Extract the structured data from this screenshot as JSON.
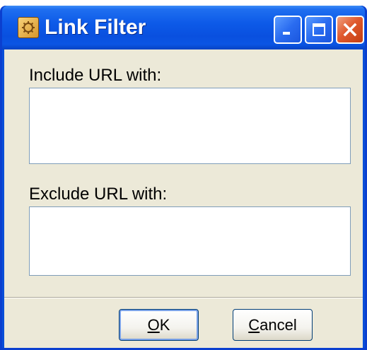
{
  "window": {
    "title": "Link Filter",
    "icon": "filter-app-icon",
    "controls": {
      "minimize": "minimize-icon",
      "maximize": "maximize-icon",
      "close": "close-icon"
    }
  },
  "form": {
    "include_label": "Include URL with:",
    "include_value": "",
    "exclude_label": "Exclude URL with:",
    "exclude_value": ""
  },
  "buttons": {
    "ok_mnemonic": "O",
    "ok_rest": "K",
    "cancel_mnemonic": "C",
    "cancel_rest": "ancel"
  },
  "colors": {
    "titlebar": "#0a4fd8",
    "client_background": "#ece9d8",
    "close_button": "#e05a2e"
  }
}
